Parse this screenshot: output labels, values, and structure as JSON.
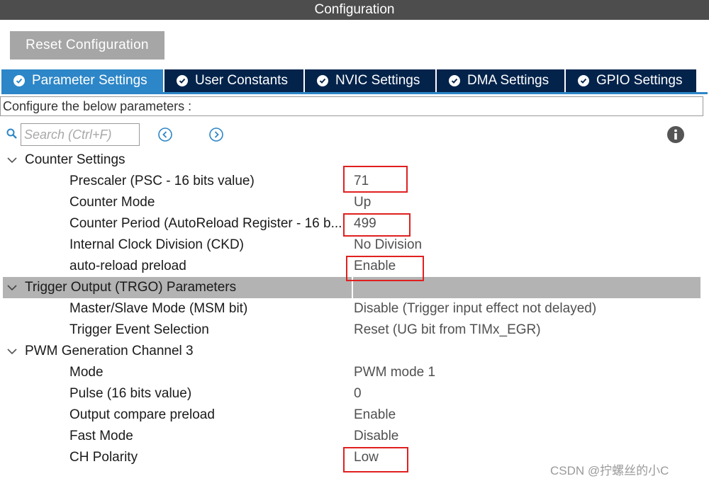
{
  "window": {
    "title": "Configuration"
  },
  "toolbar": {
    "reset_label": "Reset Configuration"
  },
  "tabs": [
    {
      "label": "Parameter Settings",
      "active": true
    },
    {
      "label": "User Constants",
      "active": false
    },
    {
      "label": "NVIC Settings",
      "active": false
    },
    {
      "label": "DMA Settings",
      "active": false
    },
    {
      "label": "GPIO Settings",
      "active": false
    }
  ],
  "description": "Configure the below parameters :",
  "search": {
    "placeholder": "Search (Ctrl+F)",
    "value": ""
  },
  "groups": [
    {
      "label": "Counter Settings",
      "params": [
        {
          "name": "Prescaler (PSC - 16 bits value)",
          "value": "71"
        },
        {
          "name": "Counter Mode",
          "value": "Up"
        },
        {
          "name": "Counter Period (AutoReload Register - 16 b...",
          "value": "499"
        },
        {
          "name": "Internal Clock Division (CKD)",
          "value": "No Division"
        },
        {
          "name": "auto-reload preload",
          "value": "Enable"
        }
      ]
    },
    {
      "label": "Trigger Output (TRGO) Parameters",
      "params": [
        {
          "name": "Master/Slave Mode (MSM bit)",
          "value": "Disable (Trigger input effect not delayed)"
        },
        {
          "name": "Trigger Event Selection",
          "value": "Reset (UG bit from TIMx_EGR)"
        }
      ]
    },
    {
      "label": "PWM Generation Channel 3",
      "params": [
        {
          "name": "Mode",
          "value": "PWM mode 1"
        },
        {
          "name": "Pulse (16 bits value)",
          "value": "0"
        },
        {
          "name": "Output compare preload",
          "value": "Enable"
        },
        {
          "name": "Fast Mode",
          "value": "Disable"
        },
        {
          "name": "CH Polarity",
          "value": "Low"
        }
      ]
    }
  ],
  "watermark": "CSDN @拧螺丝的小C",
  "colors": {
    "title_bar": "#4d4d4d",
    "tab_active": "#2d86c7",
    "tab_inactive": "#03234b",
    "selected_row": "#b3b3b3",
    "highlight": "#e02020",
    "accent": "#2d86c7"
  }
}
